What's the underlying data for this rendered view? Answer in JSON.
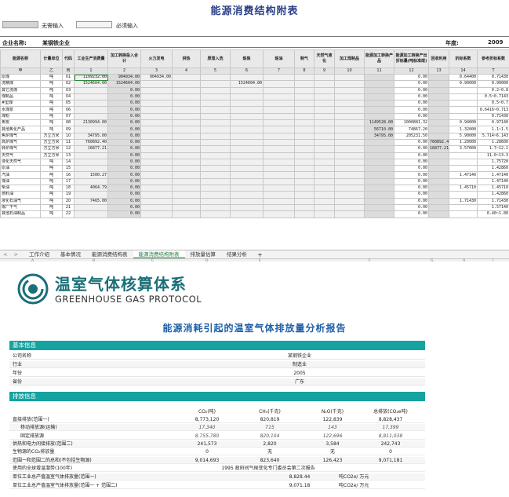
{
  "sheet": {
    "title": "能源消费结构附表",
    "legend": [
      {
        "label": "无需输入",
        "color": "#d4d4d4"
      },
      {
        "label": "必须输入",
        "color": "#f4f4f4"
      }
    ],
    "company_label": "企业名称:",
    "company_value": "某钢铁企业",
    "year_label": "年度:",
    "year_value": "2009",
    "headers": {
      "name": "能源名称",
      "unit": "计量单位",
      "code": "代码",
      "industrial": "工业生产消费量",
      "conv_total": "加工转换投入合计",
      "power": "火力发电",
      "heat": "供热",
      "coking": "原煤入洗",
      "coke": "炼焦",
      "refine": "炼油",
      "gasmake": "制气",
      "lng": "天然气液化",
      "coalprod": "加工煤制品",
      "conv_product": "能源加工转换产品",
      "conv_out": "能源加工转换产出折标量(吨标准煤)",
      "recycle": "回收利用",
      "factor": "折标系数",
      "ref_factor": "参考折标系数"
    },
    "index_row": [
      "甲",
      "乙",
      "丙",
      "1",
      "2",
      "3",
      "4",
      "5",
      "6",
      "7",
      "8",
      "9",
      "10",
      "11",
      "12",
      "13",
      "14",
      "T"
    ],
    "rows": [
      {
        "name": "原煤",
        "unit": "吨",
        "code": "01",
        "v1": "1199232.00",
        "v2": "904934.00",
        "v3": "904934.00",
        "v6": "",
        "v11": "",
        "v12": "0.00",
        "v13": "",
        "v14": "0.64400",
        "ref": "0.71430"
      },
      {
        "name": "洗精煤",
        "unit": "吨",
        "code": "02",
        "v1": "1524604.00",
        "v2": "1524604.00",
        "v3": "",
        "v6": "1524604.00",
        "v11": "",
        "v12": "0.00",
        "v13": "",
        "v14": "0.90000",
        "ref": "0.90000"
      },
      {
        "name": "其它洗煤",
        "unit": "吨",
        "code": "03",
        "v1": "",
        "v2": "0.00",
        "v3": "",
        "v6": "",
        "v11": "",
        "v12": "0.00",
        "v13": "",
        "v14": "",
        "ref": "0.2~0.8"
      },
      {
        "name": "煤制品",
        "unit": "吨",
        "code": "04",
        "v1": "",
        "v2": "0.00",
        "v3": "",
        "v6": "",
        "v11": "",
        "v12": "0.00",
        "v13": "",
        "v14": "",
        "ref": "0.5~0.7143"
      },
      {
        "name": "#型煤",
        "unit": "吨",
        "code": "05",
        "v1": "",
        "v2": "0.00",
        "v3": "",
        "v6": "",
        "v11": "",
        "v12": "0.00",
        "v13": "",
        "v14": "",
        "ref": "0.5~0.7"
      },
      {
        "name": "水煤浆",
        "unit": "吨",
        "code": "06",
        "v1": "",
        "v2": "0.00",
        "v3": "",
        "v6": "",
        "v11": "",
        "v12": "0.00",
        "v13": "",
        "v14": "",
        "ref": "0.6416~0.713"
      },
      {
        "name": "煤粉",
        "unit": "吨",
        "code": "07",
        "v1": "",
        "v2": "0.00",
        "v3": "",
        "v6": "",
        "v11": "",
        "v12": "0.00",
        "v13": "",
        "v14": "",
        "ref": "0.71430"
      },
      {
        "name": "焦炭",
        "unit": "吨",
        "code": "08",
        "v1": "2130994.00",
        "v2": "0.00",
        "v3": "",
        "v6": "",
        "v11": "1149528.00",
        "v12": "1000881.32",
        "v13": "",
        "v14": "0.94000",
        "ref": "0.97140"
      },
      {
        "name": "其他焦化产品",
        "unit": "吨",
        "code": "09",
        "v1": "",
        "v2": "0.00",
        "v3": "",
        "v6": "",
        "v11": "56710.00",
        "v12": "74867.20",
        "v13": "",
        "v14": "1.32000",
        "ref": "1.1~1.5"
      },
      {
        "name": "焦炉煤气",
        "unit": "万立方米",
        "code": "10",
        "v1": "34795.00",
        "v2": "0.00",
        "v3": "",
        "v6": "",
        "v11": "34795.00",
        "v12": "205231.50",
        "v13": "",
        "v14": "5.90000",
        "ref": "5.714~6.143"
      },
      {
        "name": "高炉煤气",
        "unit": "万立方米",
        "code": "11",
        "v1": "760892.40",
        "v2": "0.00",
        "v3": "",
        "v6": "",
        "v11": "",
        "v12": "0.00",
        "v13": "760892.40",
        "v14": "1.20000",
        "ref": "1.28600"
      },
      {
        "name": "转炉煤气",
        "unit": "万立方米",
        "code": "12",
        "v1": "16877.21",
        "v2": "0.00",
        "v3": "",
        "v6": "",
        "v11": "",
        "v12": "0.00",
        "v13": "16877.21",
        "v14": "3.57000",
        "ref": "1.7~12.1"
      },
      {
        "name": "天然气",
        "unit": "万立方米",
        "code": "13",
        "v1": "",
        "v2": "0.00",
        "v3": "",
        "v6": "",
        "v11": "",
        "v12": "0.00",
        "v13": "",
        "v14": "",
        "ref": "11.0~13.3"
      },
      {
        "name": "液化天然气",
        "unit": "吨",
        "code": "14",
        "v1": "",
        "v2": "0.00",
        "v3": "",
        "v6": "",
        "v11": "",
        "v12": "0.00",
        "v13": "",
        "v14": "",
        "ref": "1.75720"
      },
      {
        "name": "原油",
        "unit": "吨",
        "code": "15",
        "v1": "",
        "v2": "0.00",
        "v3": "",
        "v6": "",
        "v11": "",
        "v12": "0.00",
        "v13": "",
        "v14": "",
        "ref": "1.42860"
      },
      {
        "name": "汽油",
        "unit": "吨",
        "code": "16",
        "v1": "1500.27",
        "v2": "0.00",
        "v3": "",
        "v6": "",
        "v11": "",
        "v12": "0.00",
        "v13": "",
        "v14": "1.47140",
        "ref": "1.47140"
      },
      {
        "name": "煤油",
        "unit": "吨",
        "code": "17",
        "v1": "",
        "v2": "0.00",
        "v3": "",
        "v6": "",
        "v11": "",
        "v12": "0.00",
        "v13": "",
        "v14": "",
        "ref": "1.47140"
      },
      {
        "name": "柴油",
        "unit": "吨",
        "code": "18",
        "v1": "4064.79",
        "v2": "0.00",
        "v3": "",
        "v6": "",
        "v11": "",
        "v12": "0.00",
        "v13": "",
        "v14": "1.45710",
        "ref": "1.45710"
      },
      {
        "name": "燃料油",
        "unit": "吨",
        "code": "19",
        "v1": "",
        "v2": "0.00",
        "v3": "",
        "v6": "",
        "v11": "",
        "v12": "0.00",
        "v13": "",
        "v14": "",
        "ref": "1.42860"
      },
      {
        "name": "液化石油气",
        "unit": "吨",
        "code": "20",
        "v1": "7465.00",
        "v2": "0.00",
        "v3": "",
        "v6": "",
        "v11": "",
        "v12": "0.00",
        "v13": "",
        "v14": "1.71430",
        "ref": "1.71430"
      },
      {
        "name": "炼厂干气",
        "unit": "吨",
        "code": "21",
        "v1": "",
        "v2": "0.00",
        "v3": "",
        "v6": "",
        "v11": "",
        "v12": "0.00",
        "v13": "",
        "v14": "",
        "ref": "1.57140"
      },
      {
        "name": "其他石油制品",
        "unit": "吨",
        "code": "22",
        "v1": "",
        "v2": "0.00",
        "v3": "",
        "v6": "",
        "v11": "",
        "v12": "0.00",
        "v13": "",
        "v14": "",
        "ref": "0.40~1.80"
      }
    ],
    "tabs": [
      "工作介绍",
      "基本情况",
      "能源消费结构表",
      "能源消费结构附表",
      "排放量估算",
      "结果分析"
    ],
    "active_tab": 3,
    "nav_glyphs": "< >",
    "add_tab_glyph": "+",
    "col_letters": [
      "A",
      "B",
      "C",
      "D",
      "E",
      "F",
      "G",
      "H",
      "I"
    ]
  },
  "report": {
    "logo_cn": "温室气体核算体系",
    "logo_en": "GREENHOUSE GAS PROTOCOL",
    "title": "能源消耗引起的温室气体排放量分析报告",
    "basic_header": "基本信息",
    "basic": [
      {
        "k": "公司名称",
        "v": "某钢铁企业"
      },
      {
        "k": "行业",
        "v": "制造业"
      },
      {
        "k": "年份",
        "v": "2005"
      },
      {
        "k": "省份",
        "v": "广东"
      }
    ],
    "emission_header": "排放信息",
    "columns": [
      "CO₂(吨)",
      "CH₄(千克)",
      "N₂O(千克)",
      "总排放(CO₂e吨)"
    ],
    "emissions": [
      {
        "label": "直接排放(范围一)",
        "indent": false,
        "italic": false,
        "v": [
          "8,773,120",
          "820,819",
          "122,839",
          "8,828,437"
        ]
      },
      {
        "label": "移动排放源(运输)",
        "indent": true,
        "italic": true,
        "v": [
          "17,340",
          "715",
          "143",
          "17,399"
        ]
      },
      {
        "label": "固定排放源",
        "indent": true,
        "italic": true,
        "v": [
          "8,755,780",
          "820,104",
          "122,696",
          "8,811,038"
        ]
      },
      {
        "label": "供热和电力间接排放(范围二)",
        "indent": false,
        "italic": false,
        "v": [
          "241,573",
          "2,820",
          "3,584",
          "242,743"
        ]
      },
      {
        "label": "生物源的CO₂排放量",
        "indent": false,
        "italic": false,
        "v": [
          "0",
          "无",
          "无",
          "0"
        ]
      },
      {
        "label": "范围一和范围二的总和(不包括生物源)",
        "indent": false,
        "italic": false,
        "v": [
          "9,014,693",
          "823,640",
          "126,423",
          "9,071,181"
        ]
      }
    ],
    "gwp": {
      "label": "使用的全球增温潜势(100年)",
      "value": "1995 政府间气候变化专门委员会第二次报告"
    },
    "unit_rows": [
      {
        "label": "单位工业总产值温室气体排放量(范围一)",
        "value": "8,828.44",
        "unit": "吨CO2e/ 万元"
      },
      {
        "label": "单位工业总产值温室气体排放量(范围一 + 范围二)",
        "value": "9,071.18",
        "unit": "吨CO2e/ 万元"
      }
    ]
  }
}
